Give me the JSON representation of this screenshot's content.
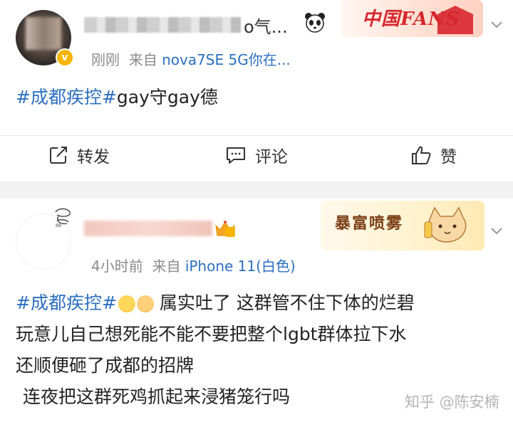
{
  "post1": {
    "name_suffix": "o气...",
    "time": "刚刚",
    "source_prefix": "来自",
    "source": "nova7SE 5G你在...",
    "verified_badge": "v",
    "banner_text": "中国FANS",
    "content": {
      "tag": "#成都疾控#",
      "text": "gay守gay德"
    },
    "actions": {
      "repost": "转发",
      "comment": "评论",
      "like": "赞"
    }
  },
  "post2": {
    "time": "4小时前",
    "source_prefix": "来自",
    "source": "iPhone 11(白色)",
    "banner_text": "暴富喷雾",
    "content": {
      "tag": "#成都疾控#",
      "line1_text": "属实吐了 这群管不住下体的烂碧",
      "line2": "玩意儿自己想死能不能不要把整个lgbt群体拉下水",
      "line3": "还顺便砸了成都的招牌",
      "line4": "连夜把这群死鸡抓起来浸猪笼行吗"
    }
  },
  "watermark": "知乎 @陈安楠",
  "icons": [
    "panda-icon",
    "chevron-down-icon",
    "repost-icon",
    "comment-icon",
    "like-icon",
    "crown-icon",
    "cat-icon"
  ],
  "colors": {
    "link": "#2c6fc2",
    "meta": "#8a8a8a",
    "verified": "#f7b500",
    "divider": "#f2f2f2"
  }
}
